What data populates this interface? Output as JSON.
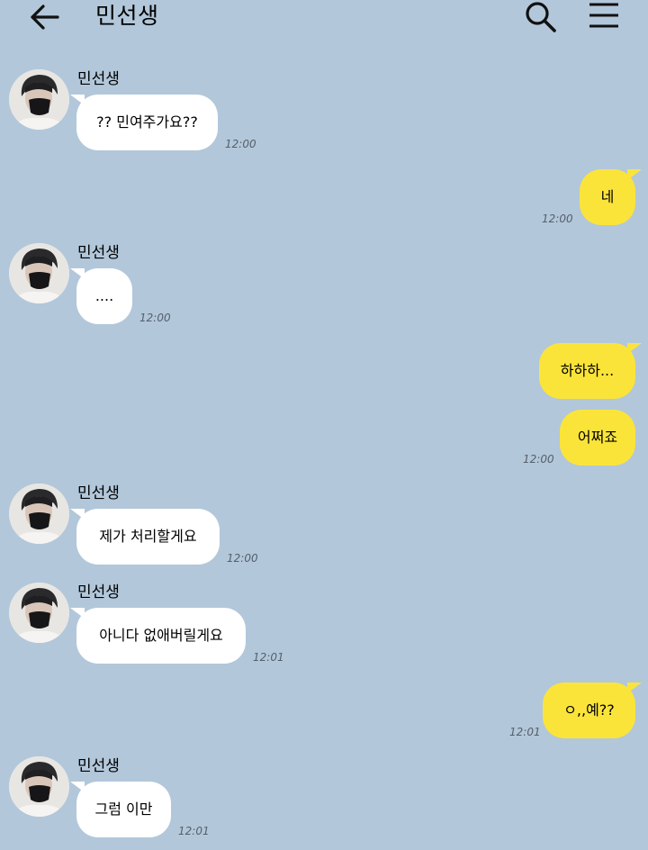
{
  "header": {
    "title": "민선생"
  },
  "messages": [
    {
      "side": "in",
      "sender": "민선생",
      "text": "?? 민여주가요??",
      "time": "12:00"
    },
    {
      "side": "out",
      "text": "네",
      "time": "12:00"
    },
    {
      "side": "in",
      "sender": "민선생",
      "text": "....",
      "time": "12:00"
    },
    {
      "side": "out",
      "text": "하하하...",
      "time": ""
    },
    {
      "side": "out",
      "text": "어쩌죠",
      "time": "12:00"
    },
    {
      "side": "in",
      "sender": "민선생",
      "text": "제가 처리할게요",
      "time": "12:00"
    },
    {
      "side": "in",
      "sender": "민선생",
      "text": "아니다 없애버릴게요",
      "time": "12:01"
    },
    {
      "side": "out",
      "text": "ㅇ,,예??",
      "time": "12:01"
    },
    {
      "side": "in",
      "sender": "민선생",
      "text": "그럼 이만",
      "time": "12:01"
    }
  ],
  "colors": {
    "background": "#b2c7da",
    "incoming_bubble": "#ffffff",
    "outgoing_bubble": "#fbe43a",
    "timestamp": "#55606c"
  },
  "icons": {
    "back": "arrow-left-icon",
    "search": "magnifier-icon",
    "menu": "hamburger-menu-icon",
    "avatar": "profile-photo-masked-person"
  }
}
